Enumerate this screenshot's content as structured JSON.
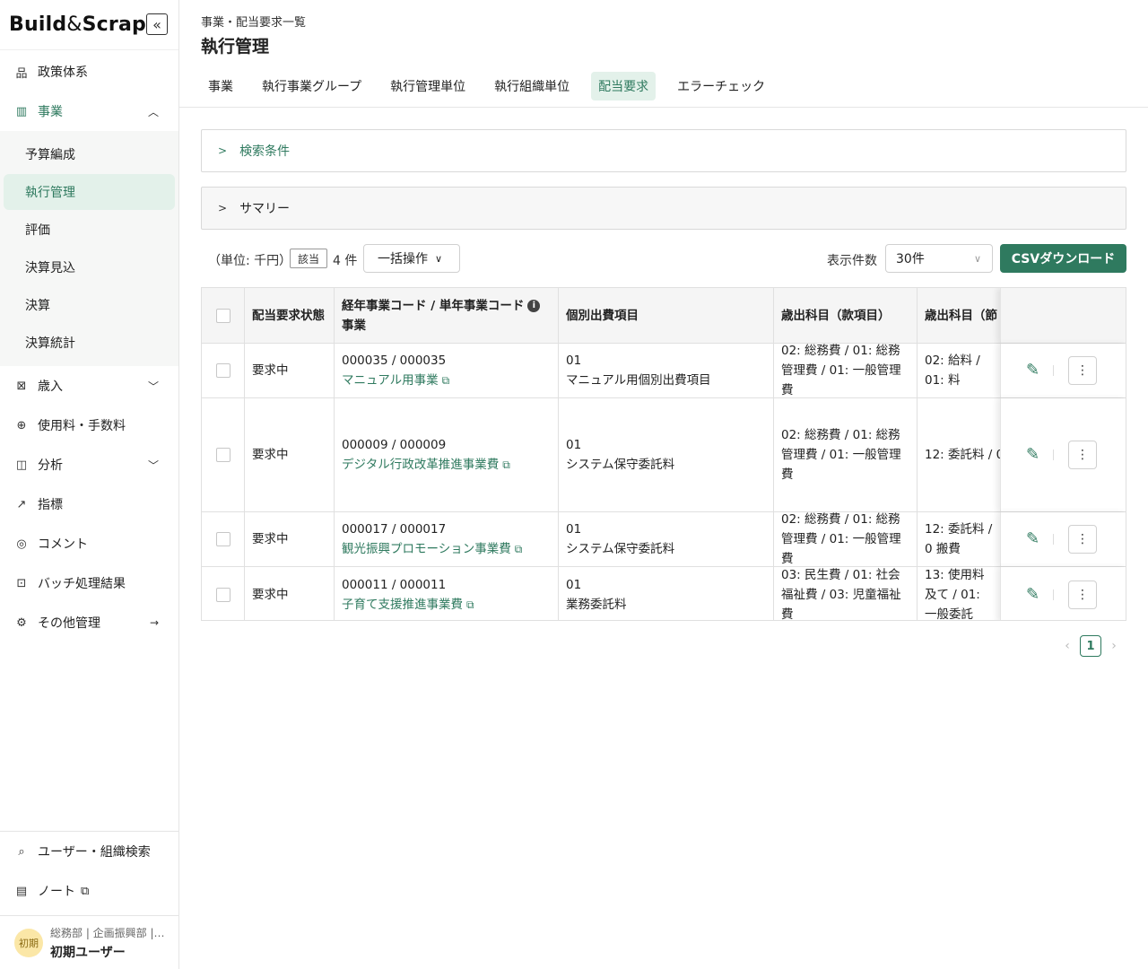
{
  "sidebar": {
    "logo": {
      "build": "Build",
      "amp": "&",
      "scrap": "Scrap"
    },
    "collapse": "«",
    "items": [
      {
        "label": "政策体系",
        "icon": "org-chart-icon"
      },
      {
        "label": "事業",
        "icon": "bar-chart-icon"
      },
      {
        "label": "歳入",
        "icon": "revenue-icon"
      },
      {
        "label": "使用料・手数料",
        "icon": "fee-icon"
      },
      {
        "label": "分析",
        "icon": "analysis-icon"
      },
      {
        "label": "指標",
        "icon": "trend-icon"
      },
      {
        "label": "コメント",
        "icon": "comment-icon"
      },
      {
        "label": "バッチ処理結果",
        "icon": "terminal-icon"
      },
      {
        "label": "その他管理",
        "icon": "settings-icon"
      }
    ],
    "subitems": [
      "予算編成",
      "執行管理",
      "評価",
      "決算見込",
      "決算",
      "決算統計"
    ],
    "bottom": [
      {
        "label": "ユーザー・組織検索",
        "icon": "search-icon"
      },
      {
        "label": "ノート",
        "icon": "book-icon"
      }
    ],
    "user": {
      "avatar": "初期",
      "dept": "総務部 | 企画振興部 | …",
      "name": "初期ユーザー"
    }
  },
  "header": {
    "breadcrumb": "事業・配当要求一覧",
    "title": "執行管理"
  },
  "tabs": [
    "事業",
    "執行事業グループ",
    "執行管理単位",
    "執行組織単位",
    "配当要求",
    "エラーチェック"
  ],
  "panels": {
    "search": "検索条件",
    "summary": "サマリー"
  },
  "toolbar": {
    "unit": "（単位: 千円）",
    "hit": "該当",
    "count": "4 件",
    "bulk": "一括操作",
    "perpage_label": "表示件数",
    "perpage": "30件",
    "csv": "CSVダウンロード"
  },
  "table": {
    "headers": {
      "status": "配当要求状態",
      "code": "経年事業コード / 単年事業コード",
      "project": "事業",
      "item": "個別出費項目",
      "account": "歳出科目（款項目）",
      "account2": "歳出科目（節"
    },
    "rows": [
      {
        "status": "要求中",
        "code": "000035 / 000035",
        "project": "マニュアル用事業",
        "item_no": "01",
        "item": "マニュアル用個別出費項目",
        "account": "02: 総務費 / 01: 総務管理費 / 01: 一般管理費",
        "account2": "02: 給料 / 01: 料"
      },
      {
        "status": "要求中",
        "code": "000009 / 000009",
        "project": "デジタル行政改革推進事業費",
        "item_no": "01",
        "item": "システム保守委託料",
        "account": "02: 総務費 / 01: 総務管理費 / 01: 一般管理費",
        "account2": "12: 委託料 / 0"
      },
      {
        "status": "要求中",
        "code": "000017 / 000017",
        "project": "観光振興プロモーション事業費",
        "item_no": "01",
        "item": "システム保守委託料",
        "account": "02: 総務費 / 01: 総務管理費 / 01: 一般管理費",
        "account2": "12: 委託料 / 0 搬費"
      },
      {
        "status": "要求中",
        "code": "000011 / 000011",
        "project": "子育て支援推進事業費",
        "item_no": "01",
        "item": "業務委託料",
        "account": "03: 民生費 / 01: 社会福祉費 / 03: 児童福祉費",
        "account2": "13: 使用料及て / 01: 一般委託"
      }
    ]
  },
  "pager": {
    "current": "1"
  }
}
